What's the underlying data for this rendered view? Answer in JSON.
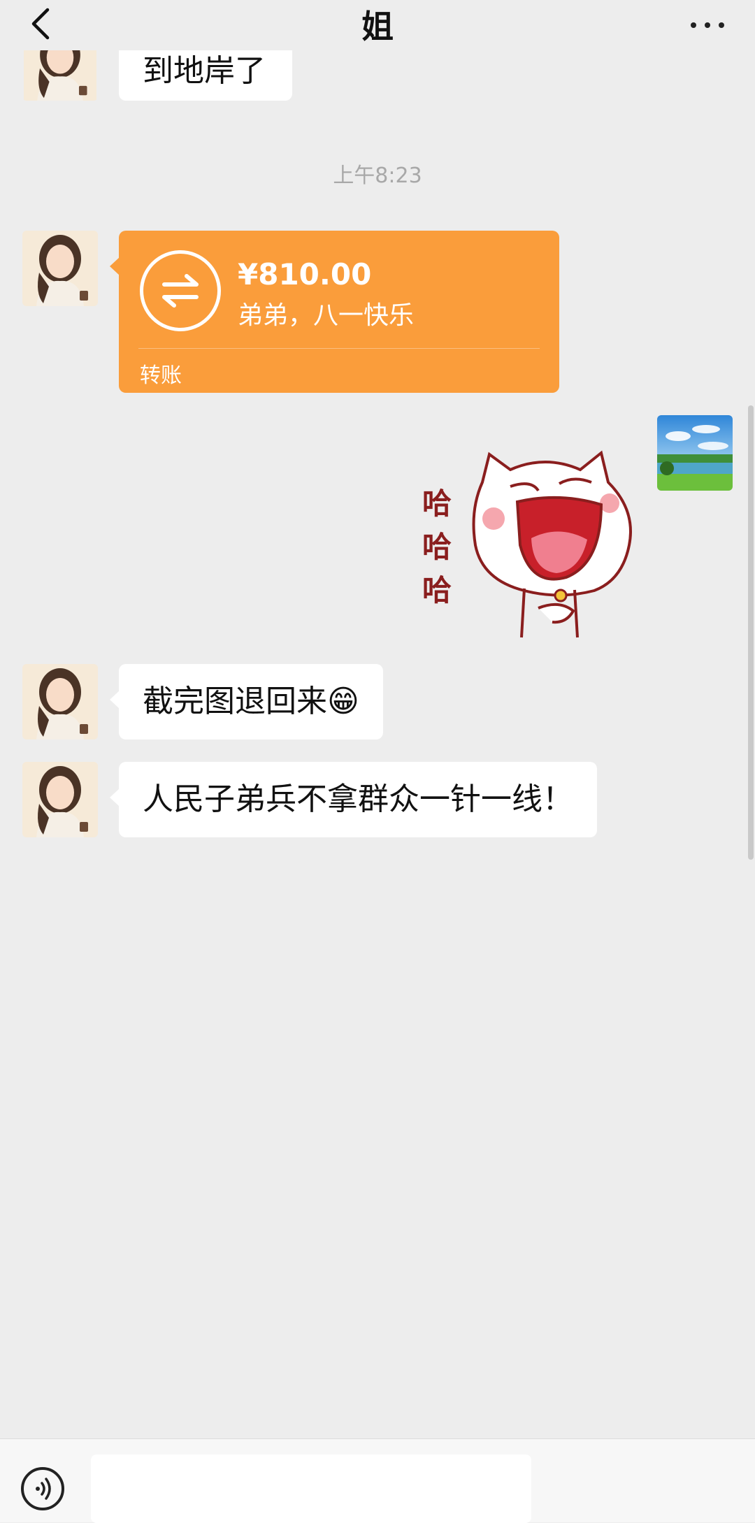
{
  "header": {
    "title": "姐"
  },
  "timestamp": "上午8:23",
  "partial_message": "到地岸了",
  "transfer": {
    "amount": "¥810.00",
    "note": "弟弟，八一快乐",
    "label": "转账",
    "color": "#fa9d3b"
  },
  "sticker": {
    "text": [
      "哈",
      "哈",
      "哈"
    ]
  },
  "messages": [
    {
      "text": "截完图退回来😁"
    },
    {
      "text": "人民子弟兵不拿群众一针一线！"
    }
  ],
  "icons": {
    "back": "chevron-left-icon",
    "more": "more-dots-icon",
    "transfer": "transfer-arrows-icon",
    "voice": "voice-icon"
  }
}
